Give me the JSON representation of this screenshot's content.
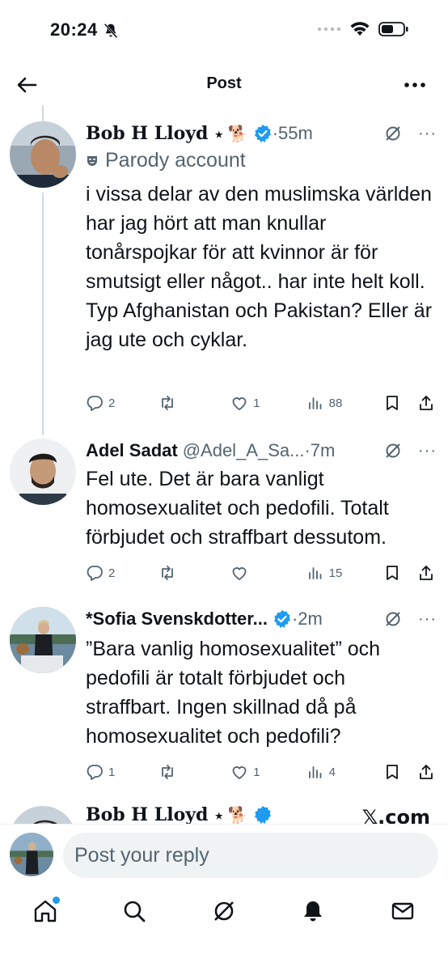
{
  "status_bar": {
    "time": "20:24"
  },
  "nav": {
    "title": "Post"
  },
  "tweets": [
    {
      "name": "Bob H Lloyd",
      "name_suffix": "⭑ 🐕",
      "handle": "",
      "time": "55m",
      "parody_label": "Parody account",
      "text": "i vissa delar av den muslimska världen har jag hört att man knullar tonårspojkar för att kvinnor är för smutsigt eller något.. har inte helt koll. Typ Afghanistan och Pakistan? Eller är jag ute och cyklar.",
      "replies": "2",
      "reposts": "",
      "likes": "1",
      "views": "88"
    },
    {
      "name": "Adel Sadat",
      "handle": "@Adel_A_Sa...",
      "time": "7m",
      "text": "Fel ute. Det är bara vanligt homosexualitet och pedofili. Totalt förbjudet och straffbart dessutom.",
      "replies": "2",
      "reposts": "",
      "likes": "",
      "views": "15"
    },
    {
      "name": "*Sofia Svenskdotter...",
      "handle": "",
      "time": "2m",
      "text": "”Bara vanlig homosexualitet” och pedofili är totalt förbjudet och straffbart. Ingen skillnad då på homosexualitet och pedofili?",
      "replies": "1",
      "reposts": "",
      "likes": "1",
      "views": "4"
    }
  ],
  "peek": {
    "name": "Bob H Lloyd",
    "watermark": "𝕏.com"
  },
  "reply": {
    "placeholder": "Post your reply"
  },
  "colors": {
    "verified": "#1d9bf0",
    "text": "#0f1419",
    "muted": "#536471",
    "line": "#cfd9de",
    "notification_dot": "#1d9bf0"
  },
  "icons": [
    "back-arrow-icon",
    "more-icon",
    "verified-icon",
    "grok-icon",
    "reply-icon",
    "repost-icon",
    "like-icon",
    "views-icon",
    "bookmark-icon",
    "share-icon",
    "home-icon",
    "search-icon",
    "bell-icon",
    "mail-icon"
  ]
}
